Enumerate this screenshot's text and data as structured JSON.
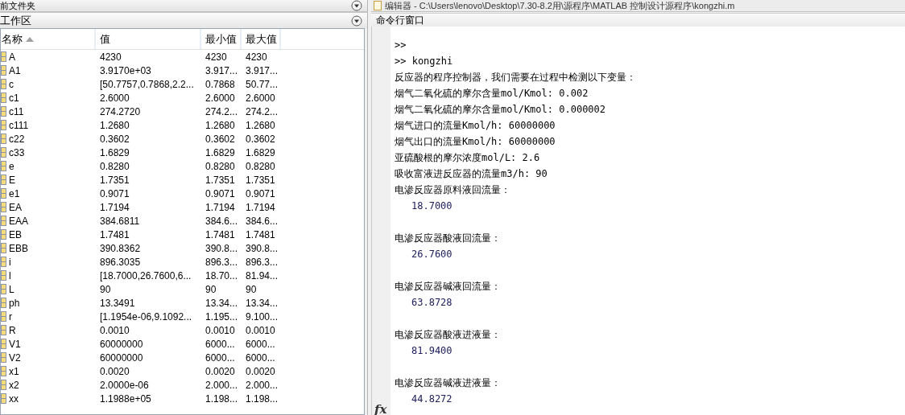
{
  "current_folder_panel": {
    "title": "前文件夹"
  },
  "workspace": {
    "title": "工作区",
    "columns": [
      {
        "label": "名称",
        "sorted": true
      },
      {
        "label": "值",
        "sorted": false
      },
      {
        "label": "最小值",
        "sorted": false
      },
      {
        "label": "最大值",
        "sorted": false
      }
    ],
    "rows": [
      [
        "A",
        "4230",
        "4230",
        "4230"
      ],
      [
        "A1",
        "3.9170e+03",
        "3.917...",
        "3.917..."
      ],
      [
        "c",
        "[50.7757,0.7868,2.2...",
        "0.7868",
        "50.77..."
      ],
      [
        "c1",
        "2.6000",
        "2.6000",
        "2.6000"
      ],
      [
        "c11",
        "274.2720",
        "274.2...",
        "274.2..."
      ],
      [
        "c111",
        "1.2680",
        "1.2680",
        "1.2680"
      ],
      [
        "c22",
        "0.3602",
        "0.3602",
        "0.3602"
      ],
      [
        "c33",
        "1.6829",
        "1.6829",
        "1.6829"
      ],
      [
        "e",
        "0.8280",
        "0.8280",
        "0.8280"
      ],
      [
        "E",
        "1.7351",
        "1.7351",
        "1.7351"
      ],
      [
        "e1",
        "0.9071",
        "0.9071",
        "0.9071"
      ],
      [
        "EA",
        "1.7194",
        "1.7194",
        "1.7194"
      ],
      [
        "EAA",
        "384.6811",
        "384.6...",
        "384.6..."
      ],
      [
        "EB",
        "1.7481",
        "1.7481",
        "1.7481"
      ],
      [
        "EBB",
        "390.8362",
        "390.8...",
        "390.8..."
      ],
      [
        "i",
        "896.3035",
        "896.3...",
        "896.3..."
      ],
      [
        "l",
        "[18.7000,26.7600,6...",
        "18.70...",
        "81.94..."
      ],
      [
        "L",
        "90",
        "90",
        "90"
      ],
      [
        "ph",
        "13.3491",
        "13.34...",
        "13.34..."
      ],
      [
        "r",
        "[1.1954e-06,9.1092...",
        "1.195...",
        "9.100..."
      ],
      [
        "R",
        "0.0010",
        "0.0010",
        "0.0010"
      ],
      [
        "V1",
        "60000000",
        "6000...",
        "6000..."
      ],
      [
        "V2",
        "60000000",
        "6000...",
        "6000..."
      ],
      [
        "x1",
        "0.0020",
        "0.0020",
        "0.0020"
      ],
      [
        "x2",
        "2.0000e-06",
        "2.000...",
        "2.000..."
      ],
      [
        "xx",
        "1.1988e+05",
        "1.198...",
        "1.198..."
      ]
    ]
  },
  "editor": {
    "title": "编辑器 - C:\\Users\\lenovo\\Desktop\\7.30-8.2用\\源程序\\MATLAB 控制设计源程序\\kongzhi.m"
  },
  "command_window": {
    "title": "命令行窗口",
    "lines": [
      {
        "kind": "prompt",
        "text": ">>"
      },
      {
        "kind": "prompt",
        "text": ">> kongzhi"
      },
      {
        "kind": "text",
        "text": "反应器的程序控制器，我们需要在过程中检测以下变量："
      },
      {
        "kind": "text",
        "text": "烟气二氧化硫的摩尔含量mol/Kmol: 0.002"
      },
      {
        "kind": "text",
        "text": "烟气二氧化硫的摩尔含量mol/Kmol: 0.000002"
      },
      {
        "kind": "text",
        "text": "烟气进口的流量Kmol/h: 60000000"
      },
      {
        "kind": "text",
        "text": "烟气出口的流量Kmol/h: 60000000"
      },
      {
        "kind": "text",
        "text": "亚硫酸根的摩尔浓度mol/L: 2.6"
      },
      {
        "kind": "text",
        "text": "吸收富液进反应器的流量m3/h: 90"
      },
      {
        "kind": "text",
        "text": "电渗反应器原料液回流量："
      },
      {
        "kind": "value",
        "text": "18.7000"
      },
      {
        "kind": "blank"
      },
      {
        "kind": "text",
        "text": "电渗反应器酸液回流量："
      },
      {
        "kind": "value",
        "text": "26.7600"
      },
      {
        "kind": "blank"
      },
      {
        "kind": "text",
        "text": "电渗反应器碱液回流量："
      },
      {
        "kind": "value",
        "text": "63.8728"
      },
      {
        "kind": "blank"
      },
      {
        "kind": "text",
        "text": "电渗反应器酸液进液量："
      },
      {
        "kind": "value",
        "text": "81.9400"
      },
      {
        "kind": "blank"
      },
      {
        "kind": "text",
        "text": "电渗反应器碱液进液量："
      },
      {
        "kind": "value",
        "text": "44.8272"
      }
    ],
    "fx": "fx"
  }
}
